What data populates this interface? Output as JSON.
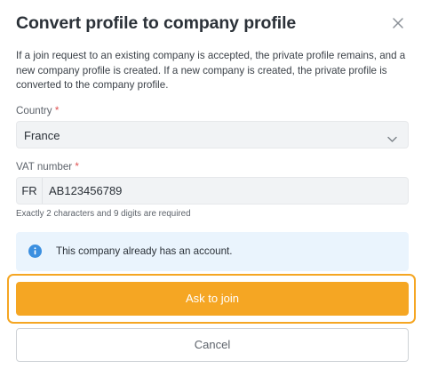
{
  "dialog": {
    "title": "Convert profile to company profile",
    "close_icon": "close-icon",
    "description": "If a join request to an existing company is accepted, the private profile remains, and a new company profile is created. If a new company is created, the private profile is converted to the company profile."
  },
  "country": {
    "label": "Country",
    "required_mark": "*",
    "value": "France",
    "icon": "chevron-down-icon"
  },
  "vat": {
    "label": "VAT number",
    "required_mark": "*",
    "prefix": "FR",
    "value": "AB123456789",
    "hint": "Exactly 2 characters and 9 digits are required"
  },
  "info": {
    "icon": "info-icon",
    "text": "This company already has an account."
  },
  "actions": {
    "join_label": "Ask to join",
    "cancel_label": "Cancel"
  },
  "colors": {
    "accent": "#f5a623",
    "info_background": "#eaf4fd",
    "info_icon": "#3b8fe0",
    "required": "#e05252"
  }
}
